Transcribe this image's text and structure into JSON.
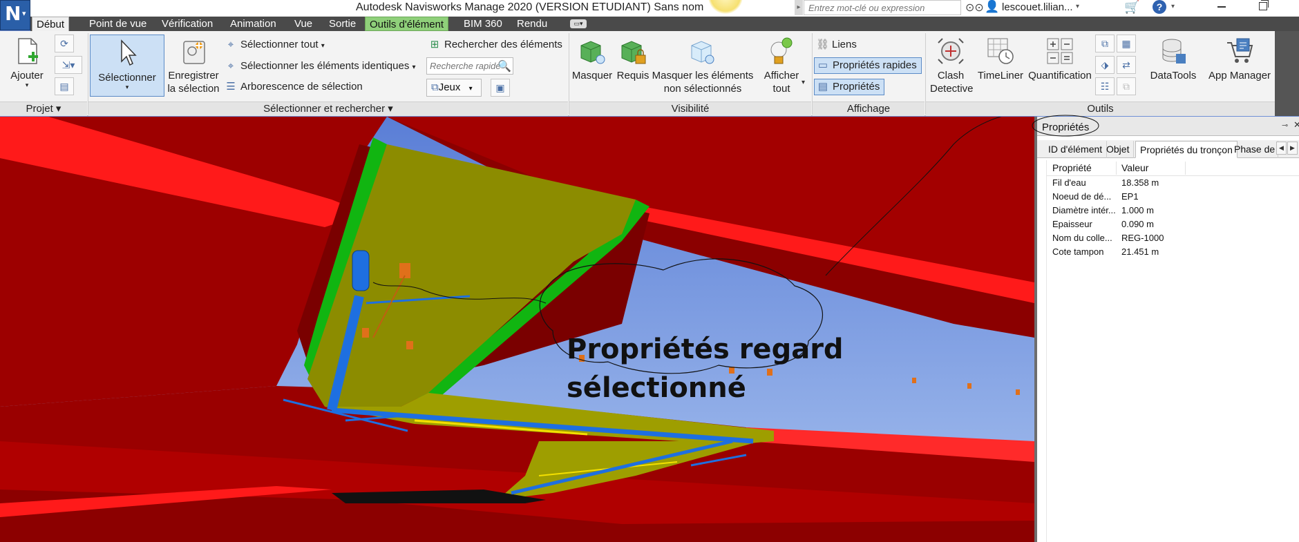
{
  "app": {
    "title": "Autodesk Navisworks Manage 2020 (VERSION ETUDIANT)    Sans nom",
    "logo_letter": "N",
    "search_placeholder": "Entrez mot-clé ou expression",
    "user_name": "lescouet.lilian...",
    "icons": [
      "navisworks-logo-icon",
      "binoculars-icon",
      "user-icon",
      "cart-icon",
      "help-icon",
      "minimize-icon",
      "maximize-icon"
    ]
  },
  "tabs": [
    {
      "label": "Début",
      "active": true
    },
    {
      "label": "Point de vue"
    },
    {
      "label": "Vérification"
    },
    {
      "label": "Animation"
    },
    {
      "label": "Vue"
    },
    {
      "label": "Sortie"
    },
    {
      "label": "Outils d'élément",
      "contextual": true,
      "color": "#8fd07a"
    },
    {
      "label": "BIM 360"
    },
    {
      "label": "Rendu"
    }
  ],
  "ribbon": {
    "projet": {
      "panel_label": "Projet",
      "add_label": "Ajouter"
    },
    "select": {
      "panel_label": "Sélectionner et rechercher",
      "select_label": "Sélectionner",
      "save_line1": "Enregistrer",
      "save_line2": "la sélection",
      "select_all": "Sélectionner tout",
      "select_same": "Sélectionner les éléments identiques",
      "selection_tree": "Arborescence de sélection",
      "find_items": "Rechercher des éléments",
      "quick_find_placeholder": "Recherche rapide",
      "sets_label": "Jeux"
    },
    "visibility": {
      "panel_label": "Visibilité",
      "hide": "Masquer",
      "required": "Requis",
      "hide_unselected_line1": "Masquer les éléments",
      "hide_unselected_line2": "non sélectionnés",
      "show_all_line1": "Afficher",
      "show_all_line2": "tout"
    },
    "display": {
      "panel_label": "Affichage",
      "links": "Liens",
      "quick_props": "Propriétés rapides",
      "props": "Propriétés"
    },
    "tools": {
      "panel_label": "Outils",
      "clash_line1": "Clash",
      "clash_line2": "Detective",
      "timeliner": "TimeLiner",
      "quantification": "Quantification",
      "datatools": "DataTools",
      "app_manager": "App Manager"
    }
  },
  "viewport": {
    "annotation_line1": "Propriétés regard",
    "annotation_line2": "sélectionné",
    "colors": {
      "sky": "#6f8fd6",
      "surface": "#a00000",
      "slab": "#8c8c00",
      "edge_green": "#11b511",
      "pipe": "#1e6fe0",
      "manhole": "#e0701a"
    }
  },
  "properties_panel": {
    "title": "Propriétés",
    "tabs": [
      "ID d'élément",
      "Objet",
      "Propriétés du tronçon",
      "Phase de c"
    ],
    "active_tab": "Propriétés du tronçon",
    "columns": {
      "property": "Propriété",
      "value": "Valeur"
    },
    "rows": [
      {
        "property": "Fil d'eau",
        "value": "18.358 m"
      },
      {
        "property": "Noeud de dé...",
        "value": "EP1"
      },
      {
        "property": "Diamètre intér...",
        "value": "1.000 m"
      },
      {
        "property": "Epaisseur",
        "value": "0.090 m"
      },
      {
        "property": "Nom du colle...",
        "value": "REG-1000"
      },
      {
        "property": "Cote tampon",
        "value": "21.451 m"
      }
    ]
  }
}
